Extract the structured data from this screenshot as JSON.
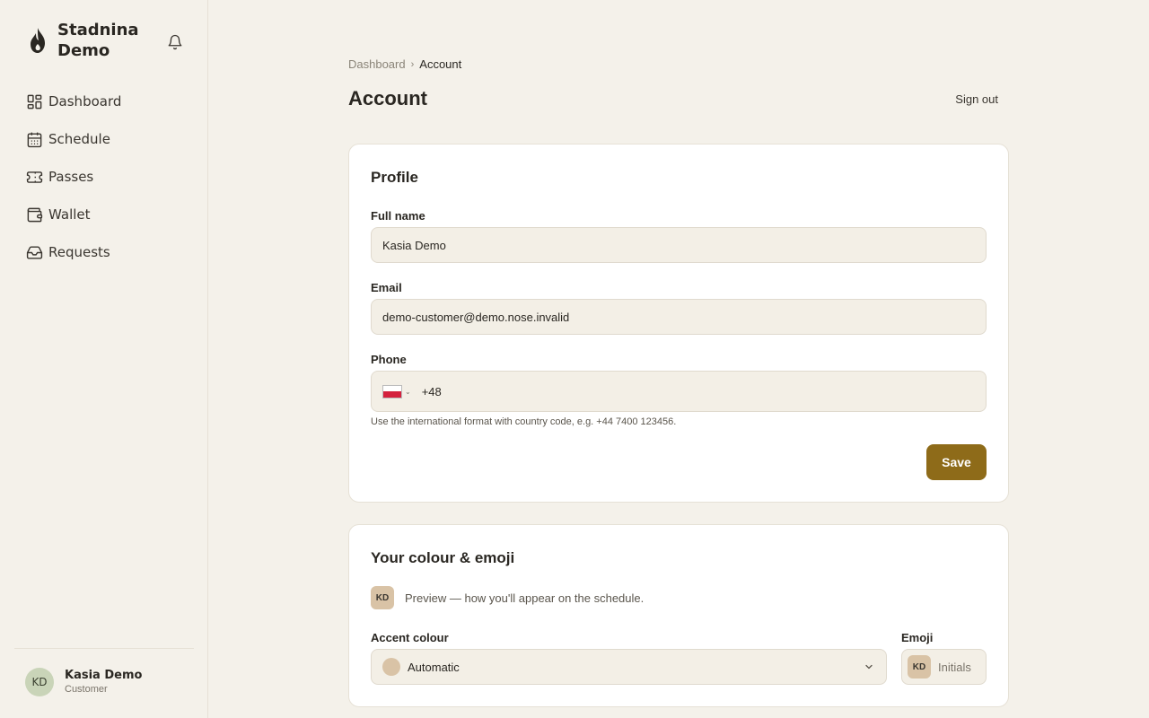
{
  "app": {
    "brand_name": "Stadnina Demo",
    "logo_icon": "flame-icon",
    "notification_icon": "bell-icon"
  },
  "sidebar": {
    "items": [
      {
        "label": "Dashboard",
        "icon": "dashboard-icon"
      },
      {
        "label": "Schedule",
        "icon": "calendar-icon"
      },
      {
        "label": "Passes",
        "icon": "ticket-icon"
      },
      {
        "label": "Wallet",
        "icon": "wallet-icon"
      },
      {
        "label": "Requests",
        "icon": "inbox-icon"
      }
    ]
  },
  "user": {
    "initials": "KD",
    "name": "Kasia Demo",
    "role": "Customer"
  },
  "breadcrumb": {
    "parent": "Dashboard",
    "separator": "›",
    "current": "Account"
  },
  "page": {
    "title": "Account",
    "sign_out": "Sign out"
  },
  "profile": {
    "title": "Profile",
    "full_name_label": "Full name",
    "full_name_value": "Kasia Demo",
    "email_label": "Email",
    "email_value": "demo-customer@demo.nose.invalid",
    "phone_label": "Phone",
    "phone_country": "PL",
    "phone_value": "+48",
    "phone_hint": "Use the international format with country code, e.g. +44 7400 123456.",
    "save_label": "Save"
  },
  "appearance": {
    "title": "Your colour & emoji",
    "preview_initials": "KD",
    "preview_text": "Preview — how you'll appear on the schedule.",
    "accent_label": "Accent colour",
    "accent_value": "Automatic",
    "emoji_label": "Emoji",
    "emoji_initials": "KD",
    "emoji_value": "Initials"
  },
  "colors": {
    "background": "#f4f1ea",
    "accent": "#8e6b19",
    "swatch": "#d9c3a6",
    "avatar": "#c9d4b8"
  }
}
